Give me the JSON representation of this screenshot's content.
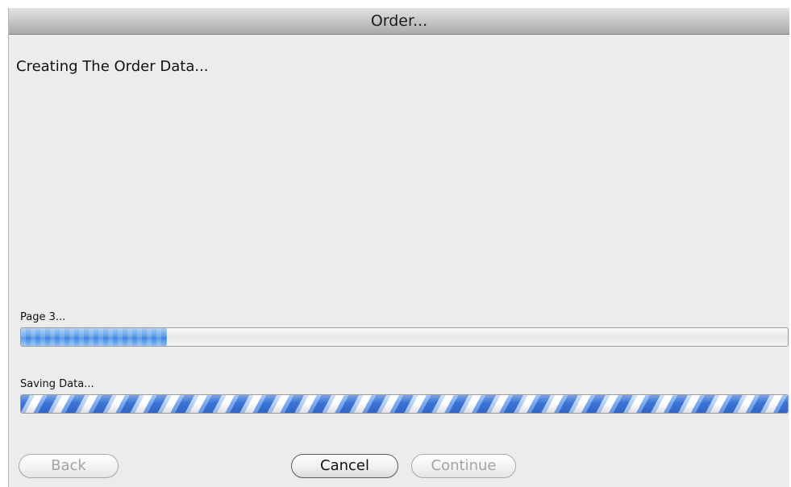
{
  "window": {
    "title": "Order..."
  },
  "dialog": {
    "heading": "Creating The Order Data..."
  },
  "progress_page": {
    "label": "Page 3...",
    "fraction": 0.19
  },
  "progress_saving": {
    "label": "Saving Data...",
    "indeterminate": true
  },
  "buttons": {
    "back": "Back",
    "cancel": "Cancel",
    "continue": "Continue"
  },
  "colors": {
    "accent_blue": "#3d86e2",
    "window_bg": "#ececec"
  }
}
